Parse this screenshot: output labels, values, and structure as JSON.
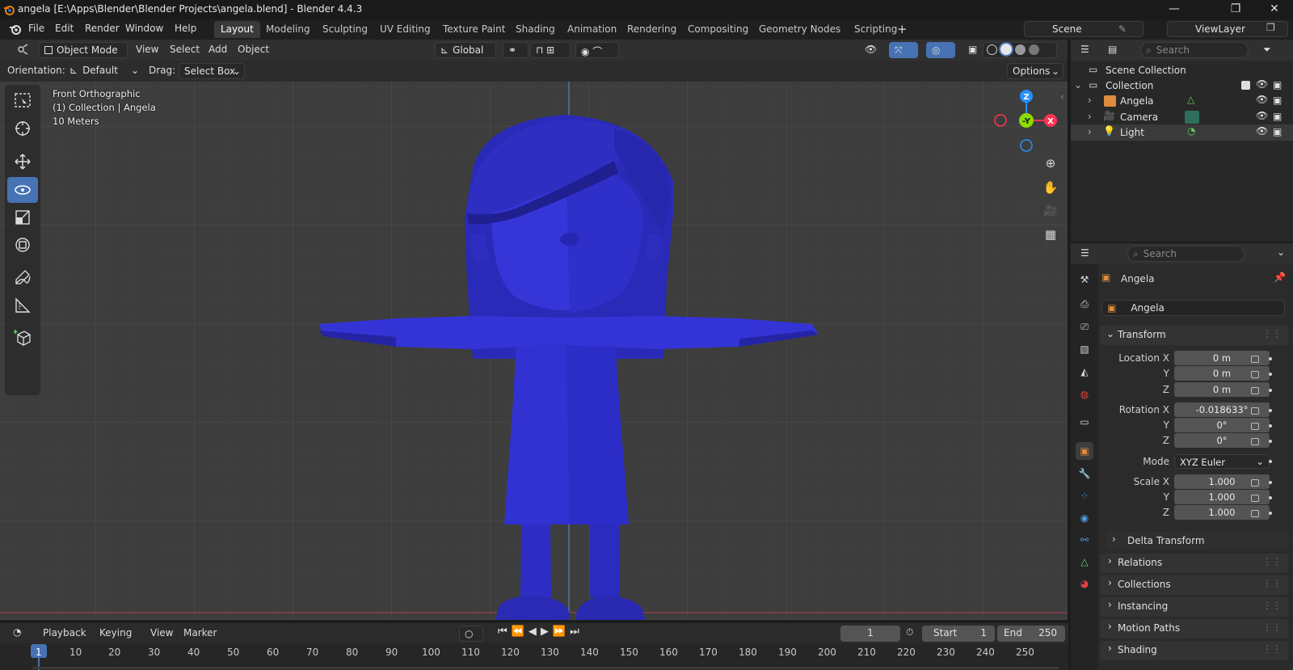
{
  "window": {
    "title": "angela [E:\\Apps\\Blender\\Blender Projects\\angela.blend] - Blender 4.4.3",
    "minimize": "—",
    "maximize": "❐",
    "close": "✕"
  },
  "menubar": {
    "items": [
      "File",
      "Edit",
      "Render",
      "Window",
      "Help"
    ],
    "workspaces": [
      "Layout",
      "Modeling",
      "Sculpting",
      "UV Editing",
      "Texture Paint",
      "Shading",
      "Animation",
      "Rendering",
      "Compositing",
      "Geometry Nodes",
      "Scripting"
    ],
    "active_workspace": "Layout",
    "add_workspace": "+",
    "scene": "Scene",
    "view_layer": "ViewLayer"
  },
  "viewport": {
    "mode": "Object Mode",
    "menus": [
      "View",
      "Select",
      "Add",
      "Object"
    ],
    "transform_orientation": "Global",
    "tool_settings": {
      "orientation_label": "Orientation:",
      "orientation_value": "Default",
      "drag_label": "Drag:",
      "drag_value": "Select Box",
      "options": "Options"
    },
    "overlay": {
      "view_name": "Front Orthographic",
      "collection_info": "(1) Collection | Angela",
      "scale": "10 Meters"
    },
    "gizmo": {
      "z": "Z",
      "y": "-Y",
      "x": "X"
    },
    "mesh_color": "#2e2ec4",
    "active_tool": "rotate"
  },
  "timeline": {
    "menus": [
      "Playback",
      "Keying",
      "View",
      "Marker"
    ],
    "current_frame": "1",
    "start_label": "Start",
    "start": "1",
    "end_label": "End",
    "end": "250",
    "ticks": [
      "1",
      "10",
      "20",
      "30",
      "40",
      "50",
      "60",
      "70",
      "80",
      "90",
      "100",
      "110",
      "120",
      "130",
      "140",
      "150",
      "160",
      "170",
      "180",
      "190",
      "200",
      "210",
      "220",
      "230",
      "240",
      "250"
    ]
  },
  "outliner": {
    "search_placeholder": "Search",
    "rows": [
      {
        "label": "Scene Collection"
      },
      {
        "label": "Collection"
      },
      {
        "label": "Angela"
      },
      {
        "label": "Camera"
      },
      {
        "label": "Light"
      }
    ]
  },
  "properties": {
    "search_placeholder": "Search",
    "object_name": "Angela",
    "data_name": "Angela",
    "transform": {
      "header": "Transform",
      "location_label": "Location X",
      "location": [
        "0 m",
        "0 m",
        "0 m"
      ],
      "rotation_label": "Rotation X",
      "rotation": [
        "-0.018633°",
        "0°",
        "0°"
      ],
      "mode_label": "Mode",
      "mode": "XYZ Euler",
      "scale_label": "Scale X",
      "scale": [
        "1.000",
        "1.000",
        "1.000"
      ],
      "y": "Y",
      "z": "Z",
      "delta": "Delta Transform"
    },
    "panels": [
      "Relations",
      "Collections",
      "Instancing",
      "Motion Paths",
      "Shading"
    ]
  },
  "colors": {
    "accent": "#4772b3",
    "x_axis": "#ff3352",
    "y_axis": "#8bdc00",
    "z_axis": "#2890ff"
  }
}
